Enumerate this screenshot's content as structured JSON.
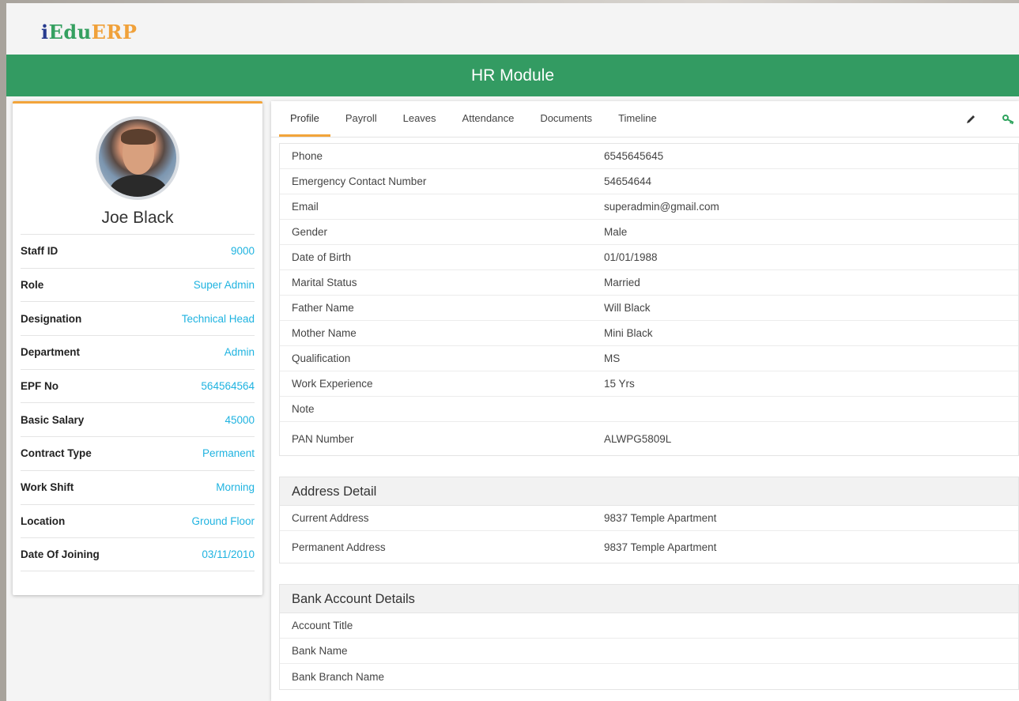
{
  "logo": {
    "part1": "i",
    "part2": "Edu",
    "part3": "ERP"
  },
  "banner": {
    "title": "HR Module"
  },
  "profile": {
    "name": "Joe Black",
    "fields": [
      {
        "label": "Staff ID",
        "value": "9000"
      },
      {
        "label": "Role",
        "value": "Super Admin"
      },
      {
        "label": "Designation",
        "value": "Technical Head"
      },
      {
        "label": "Department",
        "value": "Admin"
      },
      {
        "label": "EPF No",
        "value": "564564564"
      },
      {
        "label": "Basic Salary",
        "value": "45000"
      },
      {
        "label": "Contract Type",
        "value": "Permanent"
      },
      {
        "label": "Work Shift",
        "value": "Morning"
      },
      {
        "label": "Location",
        "value": "Ground Floor"
      },
      {
        "label": "Date Of Joining",
        "value": "03/11/2010"
      }
    ]
  },
  "tabs": [
    "Profile",
    "Payroll",
    "Leaves",
    "Attendance",
    "Documents",
    "Timeline"
  ],
  "active_tab": "Profile",
  "tools": {
    "edit_icon": "pencil-icon",
    "key_icon": "key-icon"
  },
  "details": [
    {
      "label": "Phone",
      "value": "6545645645"
    },
    {
      "label": "Emergency Contact Number",
      "value": "54654644"
    },
    {
      "label": "Email",
      "value": "superadmin@gmail.com"
    },
    {
      "label": "Gender",
      "value": "Male"
    },
    {
      "label": "Date of Birth",
      "value": "01/01/1988"
    },
    {
      "label": "Marital Status",
      "value": "Married"
    },
    {
      "label": "Father Name",
      "value": "Will Black"
    },
    {
      "label": "Mother Name",
      "value": "Mini Black"
    },
    {
      "label": "Qualification",
      "value": "MS"
    },
    {
      "label": "Work Experience",
      "value": "15 Yrs"
    },
    {
      "label": "Note",
      "value": ""
    },
    {
      "label": "PAN Number",
      "value": "ALWPG5809L"
    }
  ],
  "address": {
    "title": "Address Detail",
    "rows": [
      {
        "label": "Current Address",
        "value": "9837 Temple Apartment"
      },
      {
        "label": "Permanent Address",
        "value": "9837 Temple Apartment"
      }
    ]
  },
  "bank": {
    "title": "Bank Account Details",
    "rows": [
      {
        "label": "Account Title",
        "value": ""
      },
      {
        "label": "Bank Name",
        "value": ""
      },
      {
        "label": "Bank Branch Name",
        "value": ""
      }
    ]
  },
  "colors": {
    "accent": "#f2a43a",
    "brand_green": "#339b62",
    "link_blue": "#1fb3e0"
  }
}
